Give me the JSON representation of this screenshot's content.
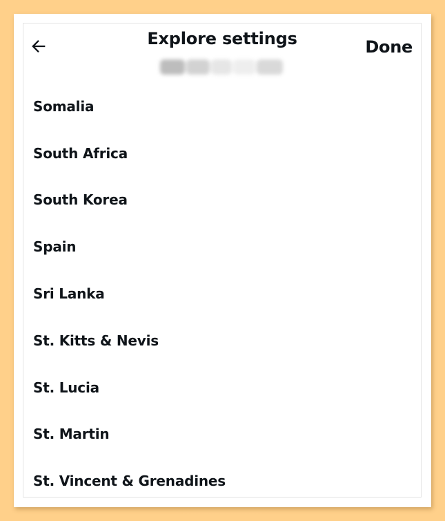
{
  "header": {
    "back_icon": "arrow-left-icon",
    "title": "Explore settings",
    "done_label": "Done"
  },
  "countries": [
    {
      "label": "Somalia"
    },
    {
      "label": "South Africa"
    },
    {
      "label": "South Korea"
    },
    {
      "label": "Spain"
    },
    {
      "label": "Sri Lanka"
    },
    {
      "label": "St. Kitts & Nevis"
    },
    {
      "label": "St. Lucia"
    },
    {
      "label": "St. Martin"
    },
    {
      "label": "St. Vincent & Grenadines"
    }
  ],
  "colors": {
    "backdrop": "#FFD08A",
    "panel": "#FFFFFF",
    "text": "#0F1419",
    "border": "#E3E3E3"
  }
}
